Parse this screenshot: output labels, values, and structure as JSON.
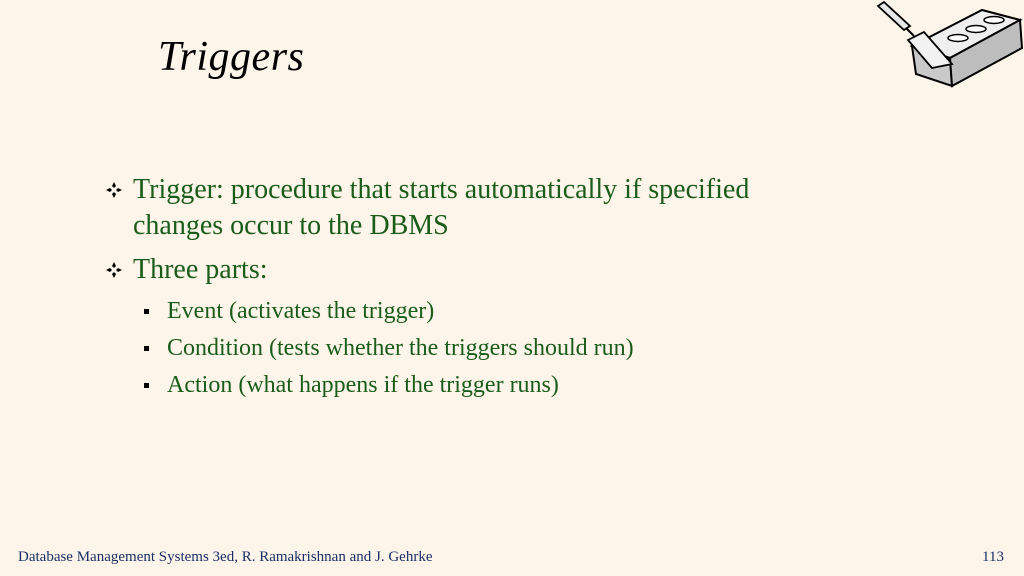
{
  "slide": {
    "title": "Triggers",
    "bullets": [
      {
        "text": "Trigger: procedure that starts automatically if specified changes occur to the DBMS",
        "line1": "Trigger: procedure that starts automatically if specified",
        "line2": "changes occur to the DBMS"
      },
      {
        "text": "Three parts:",
        "sub": [
          "Event (activates the trigger)",
          "Condition (tests whether the triggers should run)",
          "Action (what happens if the trigger runs)"
        ]
      }
    ]
  },
  "footer": {
    "citation": "Database Management Systems 3ed,  R. Ramakrishnan and J. Gehrke",
    "page_number": "113"
  },
  "colors": {
    "background": "#FDF5E9",
    "bullet_text": "#1A5C1A",
    "footer_text": "#1A2F66"
  },
  "icons": {
    "logo": "brick-and-trowel-icon",
    "bullet_marker": "four-diamond-bullet-icon",
    "sub_bullet_marker": "square-bullet-icon"
  }
}
